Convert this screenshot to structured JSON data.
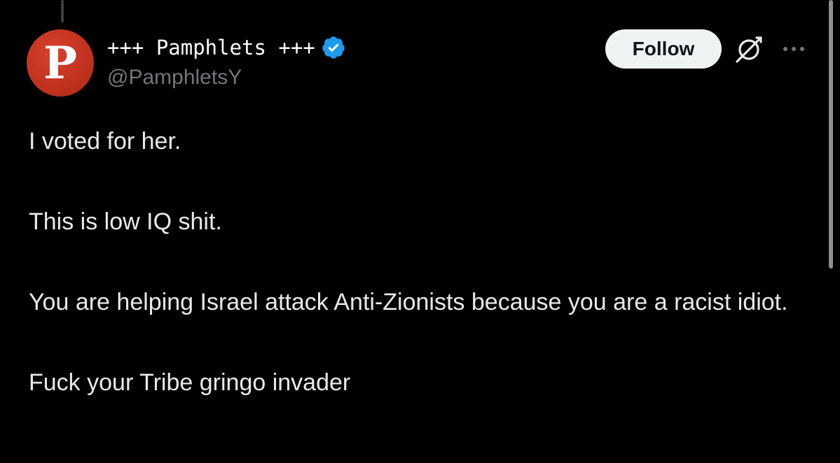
{
  "author": {
    "display_name": "+++ Pamphlets +++",
    "handle": "@PamphletsY",
    "avatar_letter": "P",
    "avatar_color": "#c0321e",
    "verified": true,
    "verified_color": "#1d9bf0"
  },
  "actions": {
    "follow_label": "Follow",
    "grok_icon": "grok-icon",
    "more_icon": "more-icon"
  },
  "tweet": {
    "line1": "I voted for her.",
    "line2": "This is low IQ shit.",
    "line3": "You are helping Israel attack Anti-Zionists because you are a racist idiot.",
    "line4": "Fuck your Tribe gringo invader"
  },
  "colors": {
    "background": "#000000",
    "text": "#e7e9ea",
    "secondary_text": "#71767b",
    "follow_bg": "#eff3f4"
  }
}
